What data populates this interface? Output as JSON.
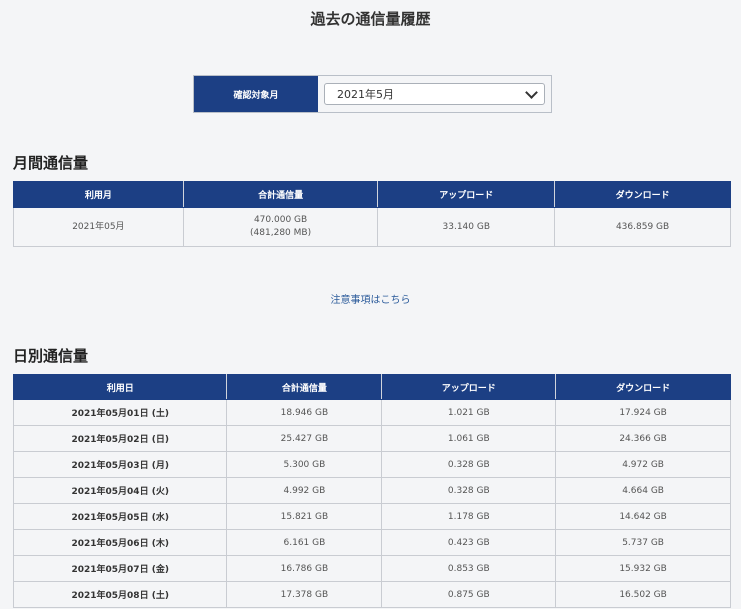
{
  "page_title": "過去の通信量履歴",
  "month_selector": {
    "label": "確認対象月",
    "selected": "2021年5月"
  },
  "monthly": {
    "title": "月間通信量",
    "headers": [
      "利用月",
      "合計通信量",
      "アップロード",
      "ダウンロード"
    ],
    "row": {
      "month": "2021年05月",
      "total_gb": "470.000 GB",
      "total_mb": "(481,280 MB)",
      "upload": "33.140 GB",
      "download": "436.859 GB"
    }
  },
  "notes_link": "注意事項はこちら",
  "daily": {
    "title": "日別通信量",
    "headers": [
      "利用日",
      "合計通信量",
      "アップロード",
      "ダウンロード"
    ],
    "rows": [
      {
        "date": "2021年05月01日 (土)",
        "total": "18.946 GB",
        "upload": "1.021 GB",
        "download": "17.924 GB"
      },
      {
        "date": "2021年05月02日 (日)",
        "total": "25.427 GB",
        "upload": "1.061 GB",
        "download": "24.366 GB"
      },
      {
        "date": "2021年05月03日 (月)",
        "total": "5.300 GB",
        "upload": "0.328 GB",
        "download": "4.972 GB"
      },
      {
        "date": "2021年05月04日 (火)",
        "total": "4.992 GB",
        "upload": "0.328 GB",
        "download": "4.664 GB"
      },
      {
        "date": "2021年05月05日 (水)",
        "total": "15.821 GB",
        "upload": "1.178 GB",
        "download": "14.642 GB"
      },
      {
        "date": "2021年05月06日 (木)",
        "total": "6.161 GB",
        "upload": "0.423 GB",
        "download": "5.737 GB"
      },
      {
        "date": "2021年05月07日 (金)",
        "total": "16.786 GB",
        "upload": "0.853 GB",
        "download": "15.932 GB"
      },
      {
        "date": "2021年05月08日 (土)",
        "total": "17.378 GB",
        "upload": "0.875 GB",
        "download": "16.502 GB"
      }
    ]
  }
}
